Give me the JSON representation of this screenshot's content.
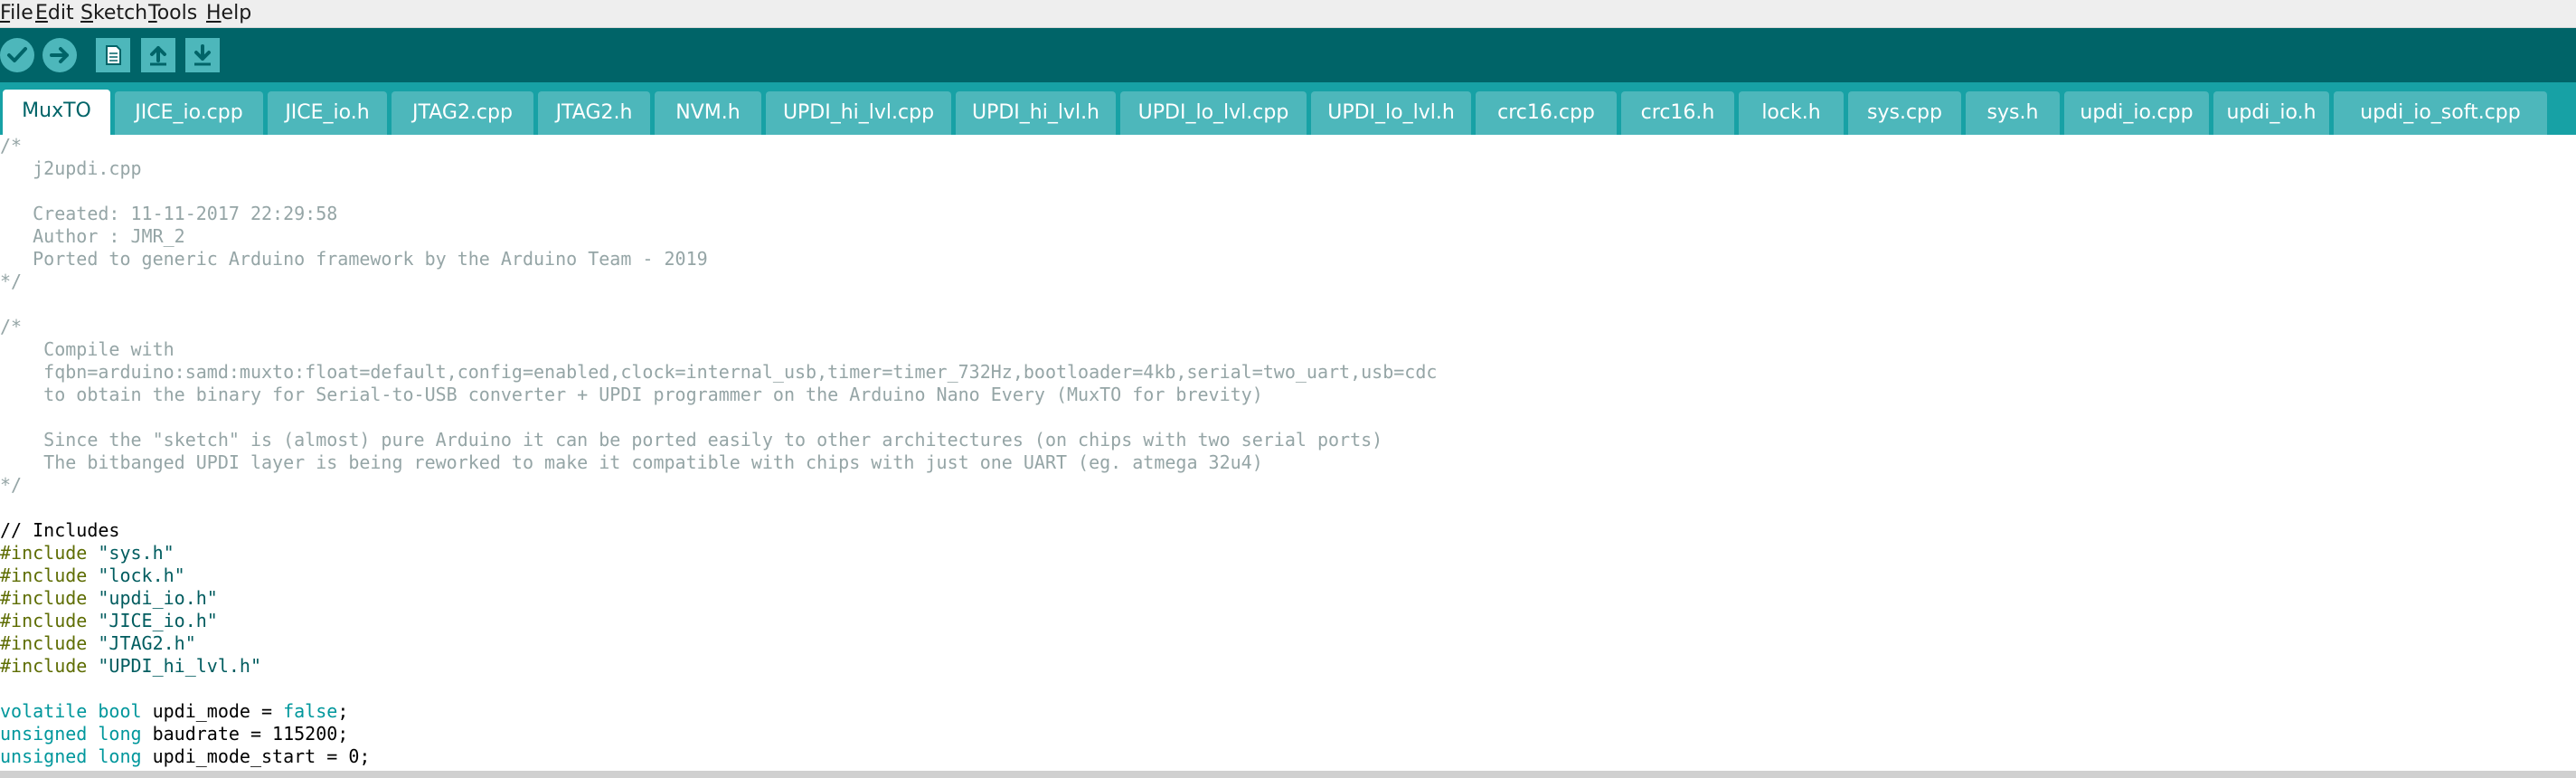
{
  "menu": {
    "file": {
      "mnemonic": "F",
      "rest": "ile"
    },
    "edit": {
      "mnemonic": "E",
      "rest": "dit"
    },
    "sketch": {
      "mnemonic": "S",
      "rest": "ketch"
    },
    "tools": {
      "mnemonic": "T",
      "rest": "ools"
    },
    "help": {
      "mnemonic": "H",
      "rest": "elp"
    }
  },
  "toolbar": {
    "verify_icon": "checkmark-icon",
    "upload_icon": "right-arrow-icon",
    "new_icon": "new-document-icon",
    "open_icon": "open-up-arrow-icon",
    "save_icon": "save-down-arrow-icon"
  },
  "colors": {
    "toolbar_bg": "#006468",
    "tabbar_bg": "#17a1a5",
    "tab_bg": "#4db7bb",
    "button_bg": "#4db7bb",
    "comment": "#95a5a6",
    "directive": "#5e6d03",
    "string": "#005c5f",
    "keyword": "#00979c"
  },
  "tabs": [
    "MuxTO",
    "JICE_io.cpp",
    "JICE_io.h",
    "JTAG2.cpp",
    "JTAG2.h",
    "NVM.h",
    "UPDI_hi_lvl.cpp",
    "UPDI_hi_lvl.h",
    "UPDI_lo_lvl.cpp",
    "UPDI_lo_lvl.h",
    "crc16.cpp",
    "crc16.h",
    "lock.h",
    "sys.cpp",
    "sys.h",
    "updi_io.cpp",
    "updi_io.h",
    "updi_io_soft.cpp"
  ],
  "active_tab": "MuxTO",
  "code": {
    "l1": "/*",
    "l2": "   j2updi.cpp",
    "l3": "",
    "l4": "   Created: 11-11-2017 22:29:58",
    "l5": "   Author : JMR_2",
    "l6": "   Ported to generic Arduino framework by the Arduino Team - 2019",
    "l7": "*/",
    "l8": "",
    "l9": "/*",
    "l10": "    Compile with",
    "l11": "    fqbn=arduino:samd:muxto:float=default,config=enabled,clock=internal_usb,timer=timer_732Hz,bootloader=4kb,serial=two_uart,usb=cdc",
    "l12": "    to obtain the binary for Serial-to-USB converter + UPDI programmer on the Arduino Nano Every (MuxTO for brevity)",
    "l13": "",
    "l14": "    Since the \"sketch\" is (almost) pure Arduino it can be ported easily to other architectures (on chips with two serial ports)",
    "l15": "    The bitbanged UPDI layer is being reworked to make it compatible with chips with just one UART (eg. atmega 32u4)",
    "l16": "*/",
    "l17": "",
    "l18": "// Includes",
    "inc_kw": "#include",
    "inc1": "\"sys.h\"",
    "inc2": "\"lock.h\"",
    "inc3": "\"updi_io.h\"",
    "inc4": "\"JICE_io.h\"",
    "inc5": "\"JTAG2.h\"",
    "inc6": "\"UPDI_hi_lvl.h\"",
    "v1_kw": "volatile",
    "v1_type": "bool",
    "v1_rest": " updi_mode = ",
    "v1_val": "false",
    "v1_end": ";",
    "v2_kw": "unsigned",
    "v2_type": "long",
    "v2_rest": " baudrate = 115200;",
    "v3_kw": "unsigned",
    "v3_type": "long",
    "v3_rest": " updi_mode_start = 0;"
  }
}
